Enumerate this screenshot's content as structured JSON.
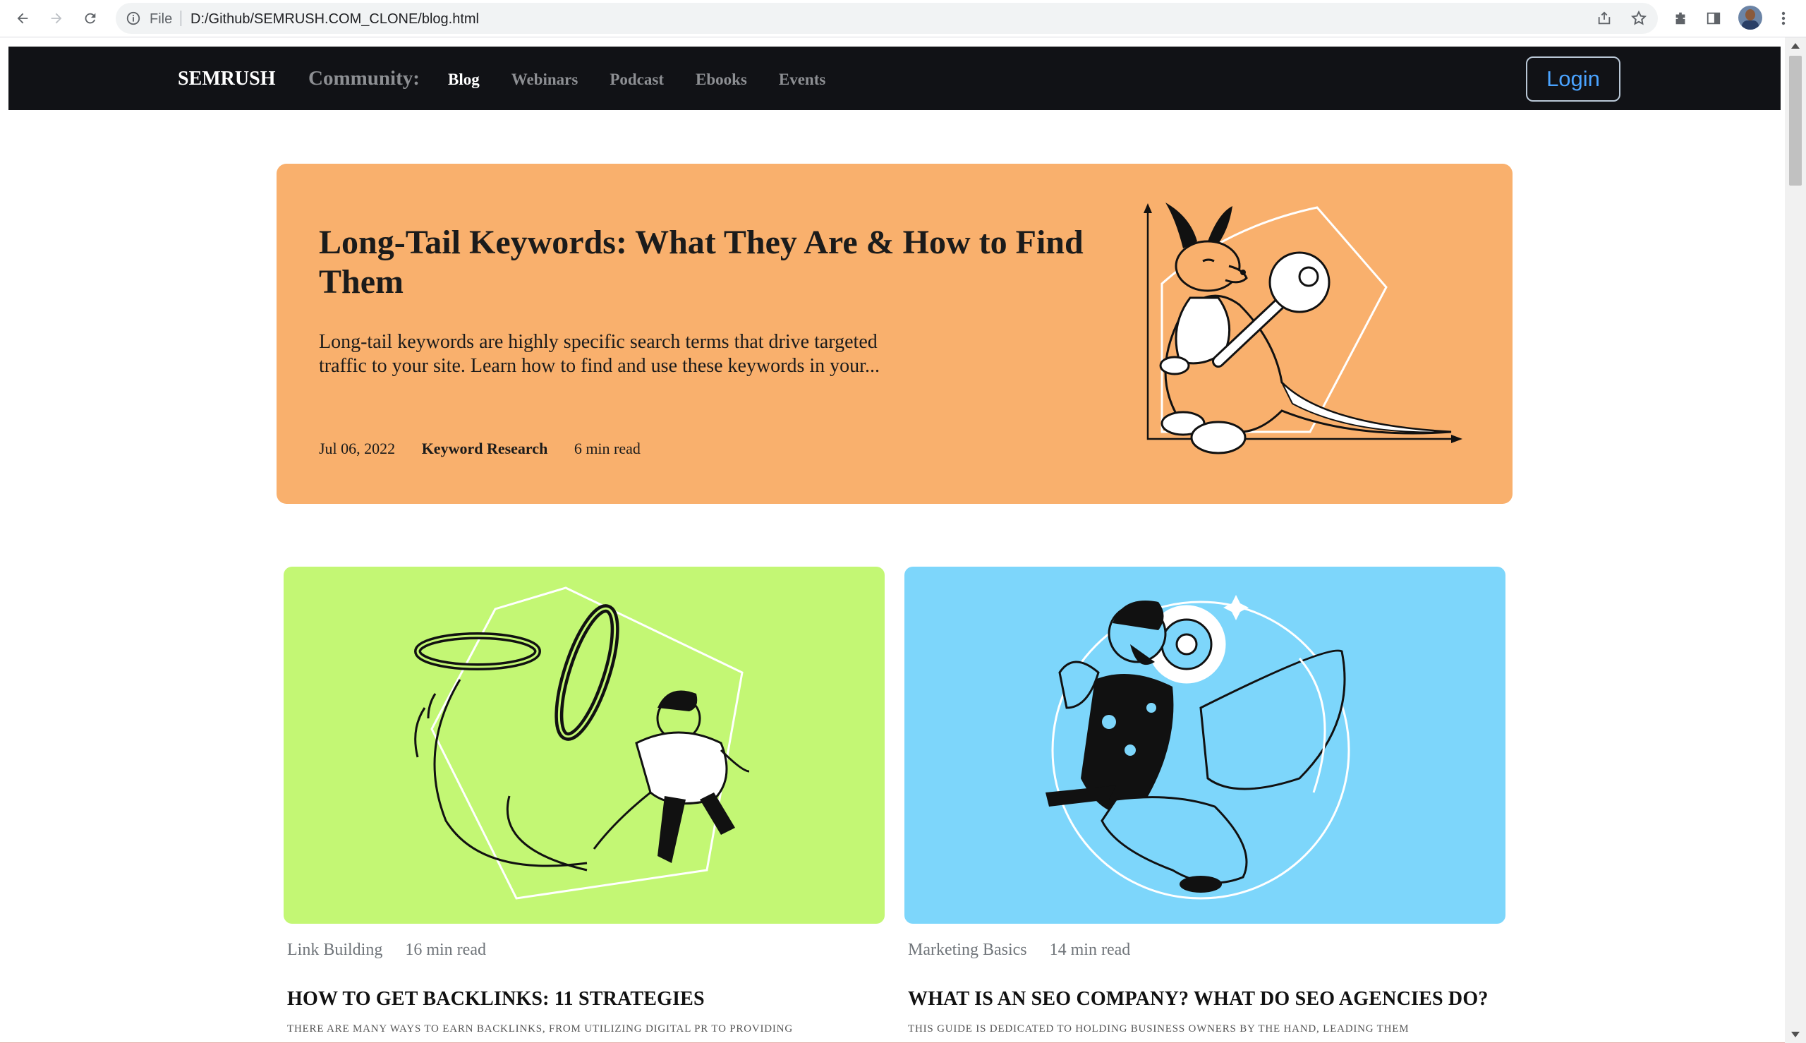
{
  "browser": {
    "scheme": "File",
    "url": "D:/Github/SEMRUSH.COM_CLONE/blog.html"
  },
  "nav": {
    "brand": "SEMRUSH",
    "community": "Community:",
    "links": [
      "Blog",
      "Webinars",
      "Podcast",
      "Ebooks",
      "Events"
    ],
    "active": "Blog",
    "login": "Login"
  },
  "hero": {
    "title": "Long-Tail Keywords: What They Are & How to Find Them",
    "description": "Long-tail keywords are highly specific search terms that drive targeted traffic to your site. Learn how to find and use these keywords in your...",
    "date": "Jul 06, 2022",
    "category": "Keyword Research",
    "read_time": "6 min read",
    "background": "#f9b06d"
  },
  "cards": [
    {
      "category": "Link Building",
      "read_time": "16 min read",
      "title": "HOW TO GET BACKLINKS: 11 STRATEGIES",
      "excerpt": "THERE ARE MANY WAYS TO EARN BACKLINKS, FROM UTILIZING DIGITAL PR TO PROVIDING",
      "background": "#c3f774"
    },
    {
      "category": "Marketing Basics",
      "read_time": "14 min read",
      "title": "WHAT IS AN SEO COMPANY? WHAT DO SEO AGENCIES DO?",
      "excerpt": "THIS GUIDE IS DEDICATED TO HOLDING BUSINESS OWNERS BY THE HAND, LEADING THEM",
      "background": "#7dd6fb"
    }
  ]
}
